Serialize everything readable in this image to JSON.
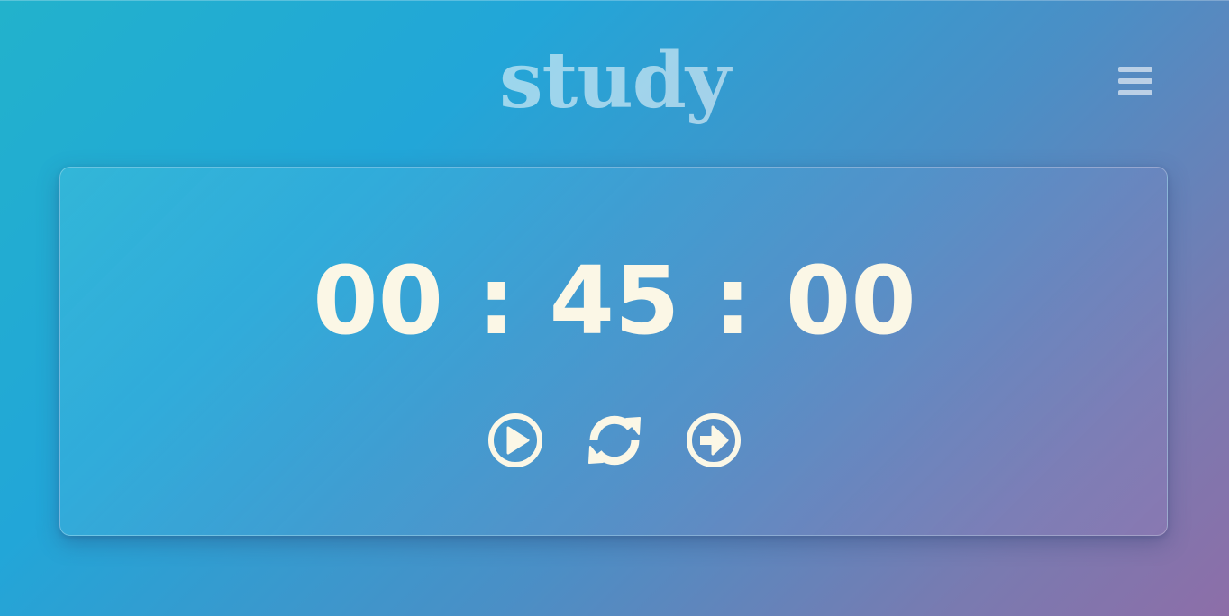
{
  "header": {
    "title": "study",
    "menu_icon": "hamburger-menu-icon"
  },
  "timer": {
    "hours": "00",
    "minutes": "45",
    "seconds": "00",
    "separator": ":"
  },
  "controls": {
    "play_icon": "play-circle-icon",
    "reset_icon": "refresh-icon",
    "next_icon": "arrow-right-circle-icon"
  },
  "colors": {
    "digit_color": "#fbf7e6",
    "title_color": "rgba(255,255,255,0.55)",
    "gradient_start": "#22b2cc",
    "gradient_end": "#8d6ea8"
  }
}
